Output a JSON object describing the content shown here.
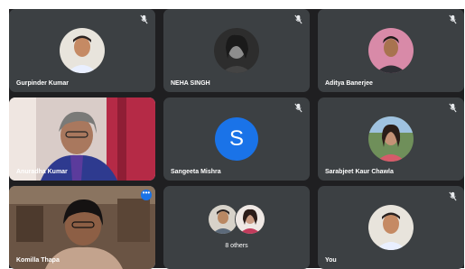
{
  "meeting": {
    "participants": [
      {
        "name": "Gurpinder Kumar",
        "muted": true
      },
      {
        "name": "NEHA SINGH",
        "muted": true
      },
      {
        "name": "Aditya Banerjee",
        "muted": true
      },
      {
        "name": "Anuradha Kumar",
        "muted": false
      },
      {
        "name": "Sangeeta Mishra",
        "muted": true,
        "initial": "S"
      },
      {
        "name": "Sarabjeet Kaur Chawla",
        "muted": true
      },
      {
        "name": "Komilla Thapa",
        "muted": false
      },
      {
        "name": "You",
        "muted": true
      }
    ],
    "others_label": "8 others",
    "more_options_glyph": "•••"
  },
  "icons": {
    "mute": "mic-off-icon",
    "more": "more-options-icon"
  },
  "colors": {
    "stage_bg": "#1f1f21",
    "tile_bg": "#3c4043",
    "initial_avatar": "#1a73e8",
    "active_outline": "#8ab4f8"
  }
}
